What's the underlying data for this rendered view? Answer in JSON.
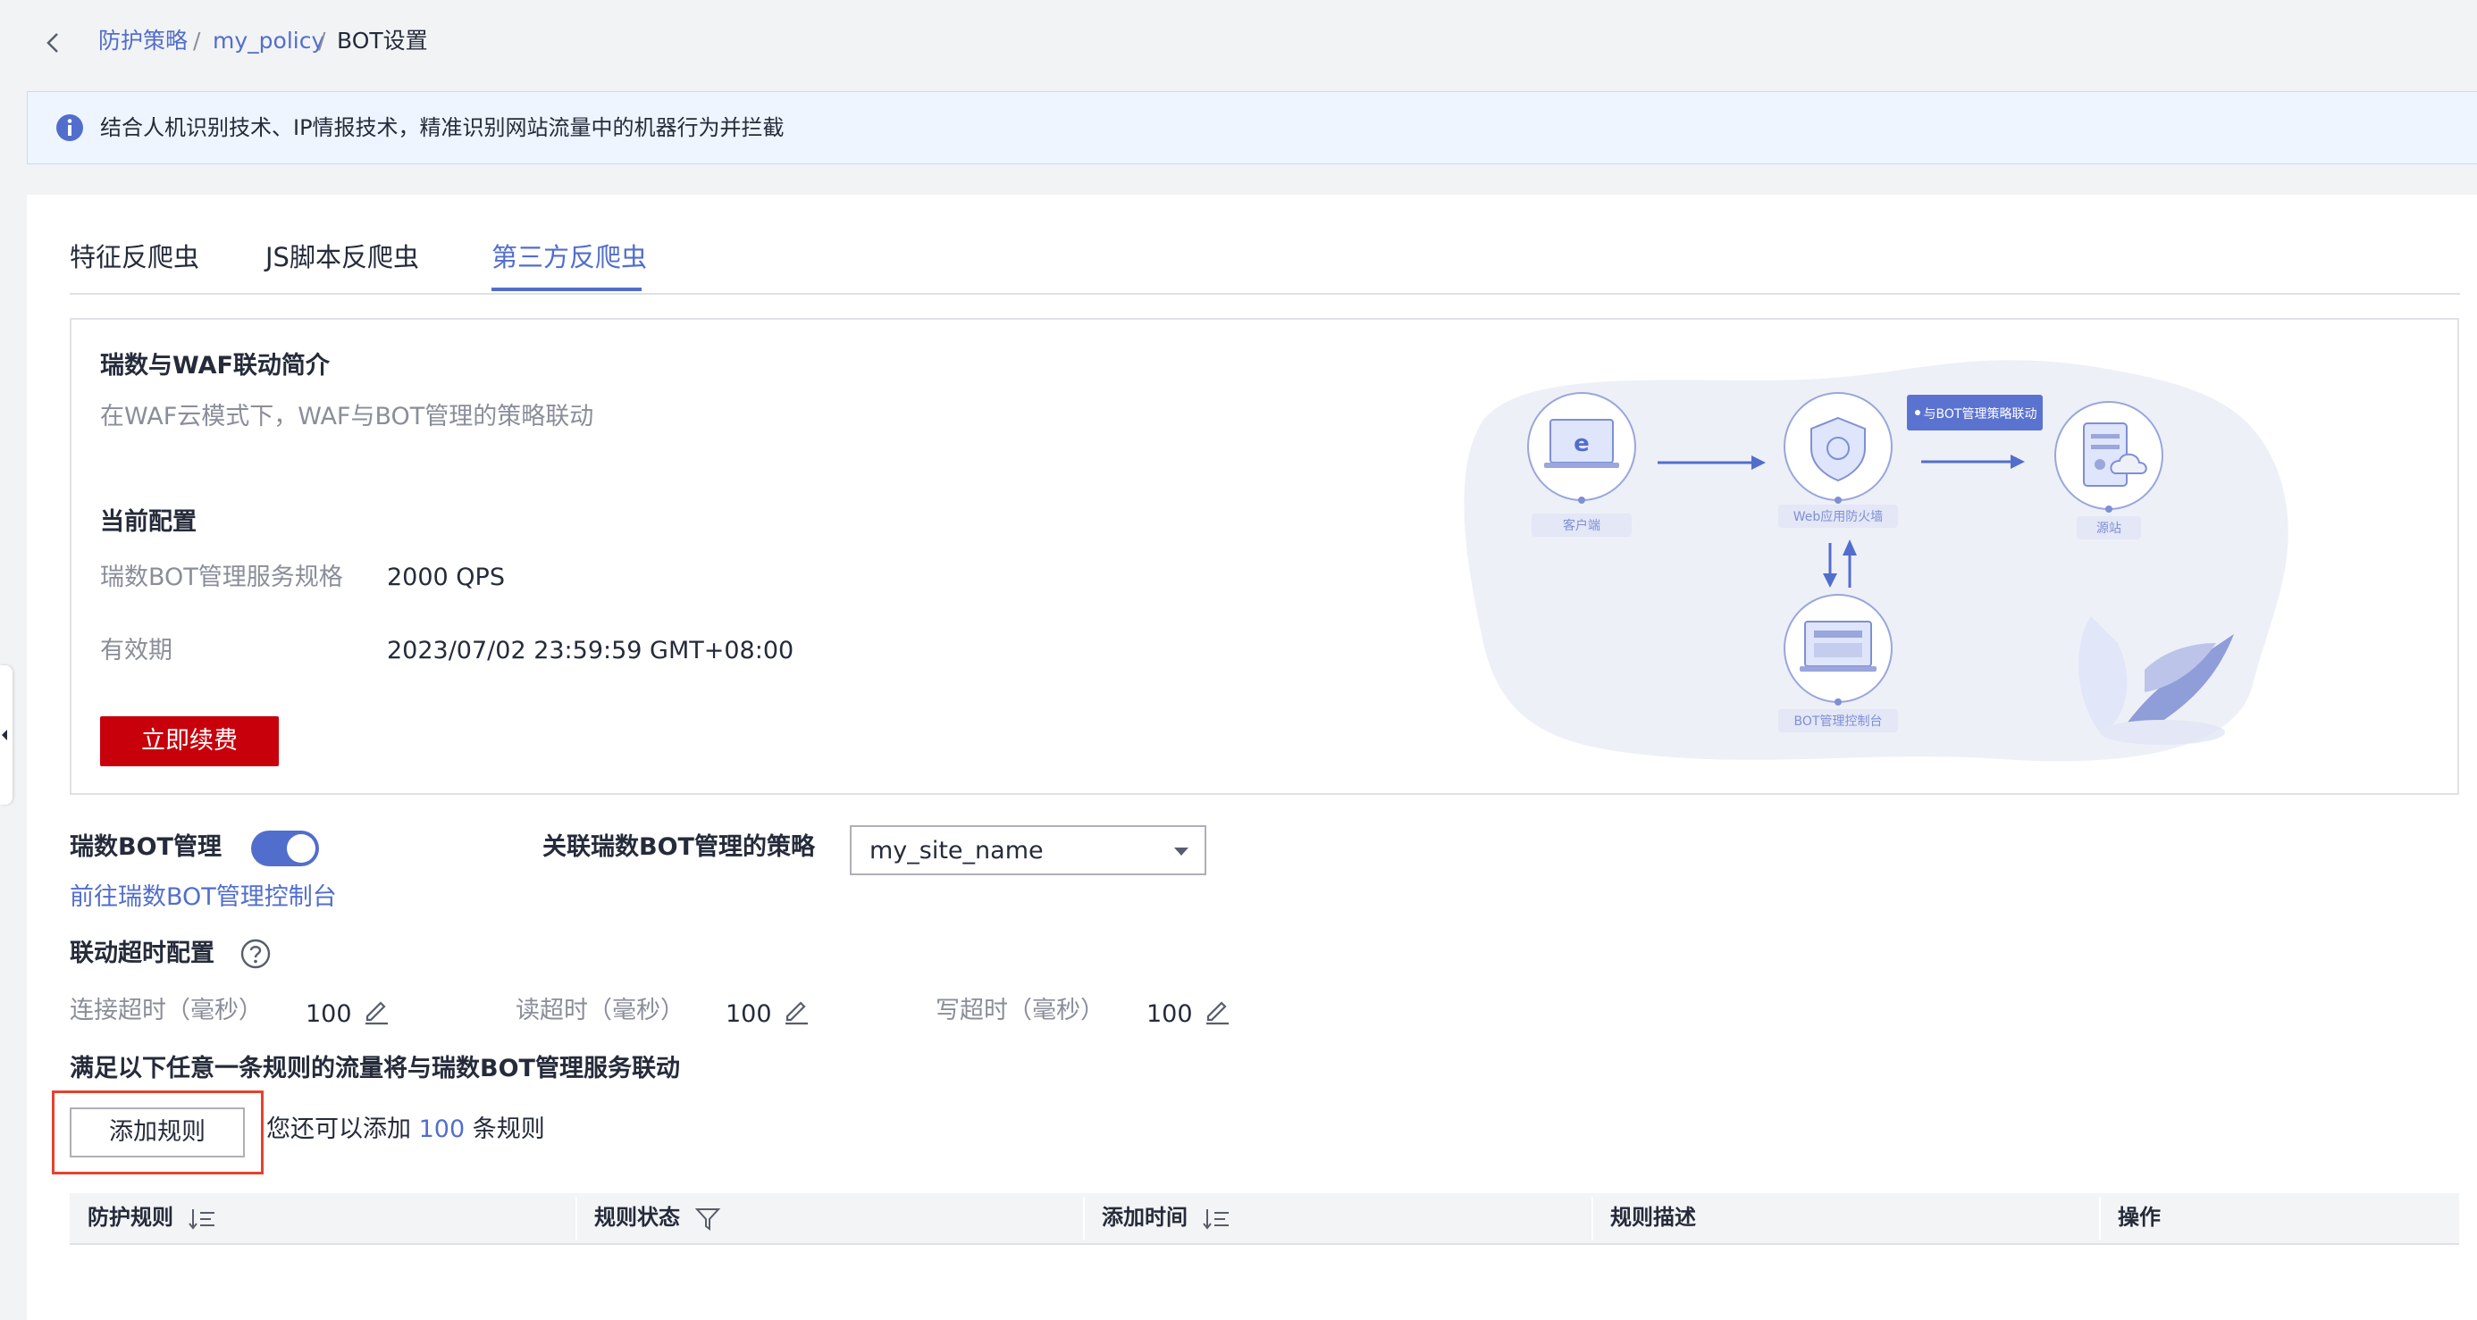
{
  "breadcrumb": {
    "items": [
      "防护策略",
      "my_policy",
      "BOT设置"
    ],
    "separator": "/"
  },
  "banner": {
    "text": "结合人机识别技术、IP情报技术，精准识别网站流量中的机器行为并拦截"
  },
  "tabs": [
    {
      "label": "特征反爬虫",
      "active": false
    },
    {
      "label": "JS脚本反爬虫",
      "active": false
    },
    {
      "label": "第三方反爬虫",
      "active": true
    }
  ],
  "intro": {
    "title": "瑞数与WAF联动简介",
    "subtitle": "在WAF云模式下，WAF与BOT管理的策略联动",
    "config_title": "当前配置",
    "spec_label": "瑞数BOT管理服务规格",
    "spec_value": "2000 QPS",
    "validity_label": "有效期",
    "validity_value": "2023/07/02 23:59:59 GMT+08:00",
    "renew_button": "立即续费"
  },
  "diagram": {
    "client_label": "客户端",
    "waf_label": "Web应用防火墙",
    "origin_label": "源站",
    "console_label": "BOT管理控制台",
    "callout": "与BOT管理策略联动"
  },
  "bot": {
    "label": "瑞数BOT管理",
    "enabled": true,
    "console_link": "前往瑞数BOT管理控制台",
    "policy_label": "关联瑞数BOT管理的策略",
    "policy_value": "my_site_name"
  },
  "timeout": {
    "title": "联动超时配置",
    "connect_label": "连接超时（毫秒）",
    "connect_value": "100",
    "read_label": "读超时（毫秒）",
    "read_value": "100",
    "write_label": "写超时（毫秒）",
    "write_value": "100"
  },
  "rules": {
    "title": "满足以下任意一条规则的流量将与瑞数BOT管理服务联动",
    "add_button": "添加规则",
    "hint_prefix": "您还可以添加",
    "hint_count": "100",
    "hint_suffix": "条规则"
  },
  "table": {
    "columns": [
      "防护规则",
      "规则状态",
      "添加时间",
      "规则描述",
      "操作"
    ]
  },
  "colors": {
    "accent": "#526ecc",
    "danger": "#c7000b",
    "highlight": "#e5422e"
  }
}
